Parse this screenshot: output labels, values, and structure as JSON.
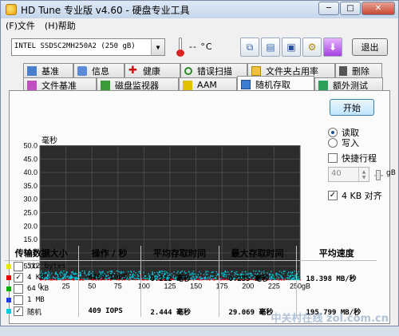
{
  "window": {
    "title": "HD Tune 专业版 v4.60 - 硬盘专业工具",
    "minimize": "─",
    "maximize": "□",
    "close": "✕"
  },
  "menu": {
    "file": "(F)文件",
    "help": "(H)帮助"
  },
  "toolbar": {
    "drive": "INTEL SSDSC2MH250A2 (250 gB)",
    "temperature": "-- °C",
    "exit": "退出"
  },
  "tabs_row1": [
    "基准",
    "信息",
    "健康",
    "错误扫描",
    "文件夹占用率",
    "删除"
  ],
  "tabs_row2": [
    "文件基准",
    "磁盘监视器",
    "AAM",
    "随机存取",
    "额外测试"
  ],
  "active_tab": "随机存取",
  "options": {
    "start": "开始",
    "read": "读取",
    "write": "写入",
    "quick_test": "快捷行程",
    "quick_value": "40",
    "quick_unit": "gB",
    "align4k": "4 KB 对齐"
  },
  "table": {
    "headers": [
      "传输数据大小",
      "操作 / 秒",
      "平均存取时间",
      "最大存取时间",
      "平均速度"
    ],
    "rows": [
      {
        "label": "512 bytes",
        "color": "#e8e800",
        "checked": false,
        "ops": "",
        "avg": "",
        "max": "",
        "speed": ""
      },
      {
        "label": "4 KB",
        "color": "#e00000",
        "checked": true,
        "ops": "4709 IOPS",
        "avg": "0.212 毫秒",
        "max": "0.235 毫秒",
        "speed": "18.398 MB/秒"
      },
      {
        "label": "64 KB",
        "color": "#00b000",
        "checked": false,
        "ops": "",
        "avg": "",
        "max": "",
        "speed": ""
      },
      {
        "label": "1 MB",
        "color": "#1f3fe0",
        "checked": false,
        "ops": "",
        "avg": "",
        "max": "",
        "speed": ""
      },
      {
        "label": "随机",
        "color": "#00c8e0",
        "checked": true,
        "ops": "409 IOPS",
        "avg": "2.444 毫秒",
        "max": "29.069 毫秒",
        "speed": "195.799 MB/秒"
      }
    ]
  },
  "chart_data": {
    "type": "scatter",
    "ylabel": "毫秒",
    "ylim": [
      0,
      50
    ],
    "xlim": [
      0,
      250
    ],
    "yticks": [
      "50.0",
      "45.0",
      "40.0",
      "35.0",
      "30.0",
      "25.0",
      "20.0",
      "15.0",
      "10.0",
      "5.00"
    ],
    "xticks": [
      "0",
      "25",
      "50",
      "75",
      "100",
      "125",
      "150",
      "175",
      "200",
      "225",
      "250gB"
    ],
    "grid": true,
    "background": "#2b2b2b",
    "series": [
      {
        "name": "随机",
        "color": "#00c8e0",
        "y_band": [
          0.3,
          3.5
        ]
      },
      {
        "name": "4 KB",
        "color": "#e00000",
        "y_band": [
          0.1,
          0.4
        ]
      }
    ]
  },
  "watermark": "中关村在线 zol.com.cn"
}
